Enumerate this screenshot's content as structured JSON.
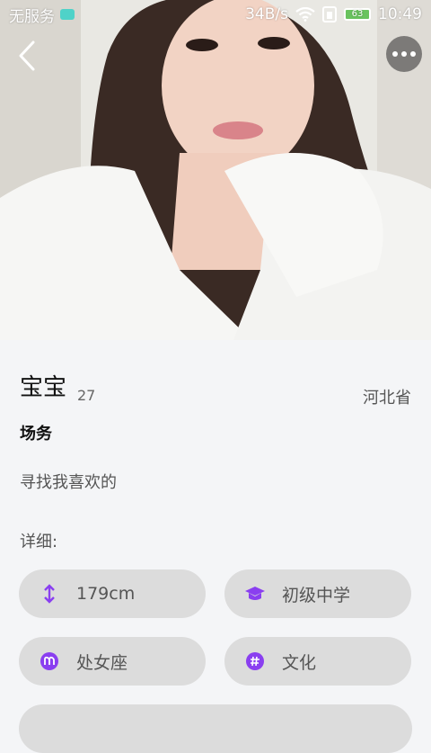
{
  "status_bar": {
    "carrier": "无服务",
    "speed": "34B/s",
    "battery": "63",
    "time": "10:49"
  },
  "profile": {
    "name": "宝宝",
    "age": "27",
    "location": "河北省",
    "occupation": "场务",
    "signature": "寻找我喜欢的",
    "details_label": "详细:"
  },
  "details": [
    {
      "icon": "height-icon",
      "text": "179cm"
    },
    {
      "icon": "graduation-cap-icon",
      "text": "初级中学"
    },
    {
      "icon": "zodiac-virgo-icon",
      "text": "处女座"
    },
    {
      "icon": "hashtag-icon",
      "text": "文化"
    }
  ],
  "colors": {
    "accent": "#8a3ff0",
    "pill_bg": "#dcdcdc",
    "page_bg": "#f4f5f7"
  }
}
